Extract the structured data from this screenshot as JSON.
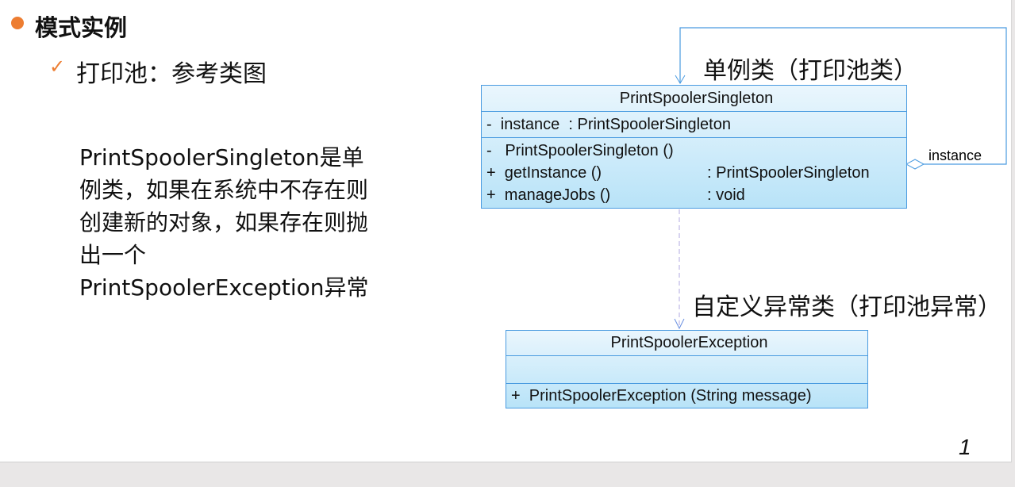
{
  "heading": "模式实例",
  "subheading": "打印池：参考类图",
  "description": "PrintSpoolerSingleton是单例类，如果在系统中不存在则创建新的对象，如果存在则抛出一个PrintSpoolerException异常",
  "diagram": {
    "singleton": {
      "name": "PrintSpoolerSingleton",
      "attributes": [
        "-  instance  : PrintSpoolerSingleton"
      ],
      "operations": [
        {
          "sig": "-   PrintSpoolerSingleton ()",
          "ret": ""
        },
        {
          "sig": "+  getInstance ()",
          "ret": ": PrintSpoolerSingleton"
        },
        {
          "sig": "+  manageJobs ()",
          "ret": ": void"
        }
      ]
    },
    "exception": {
      "name": "PrintSpoolerException",
      "operations": [
        "+  PrintSpoolerException (String message)"
      ]
    },
    "assoc_label": "instance",
    "singleton_caption": "单例类（打印池类）",
    "exception_caption": "自定义异常类（打印池异常）",
    "colors": {
      "accent": "#ed7d31",
      "uml_border": "#4a9be0"
    }
  },
  "page_number": "1"
}
